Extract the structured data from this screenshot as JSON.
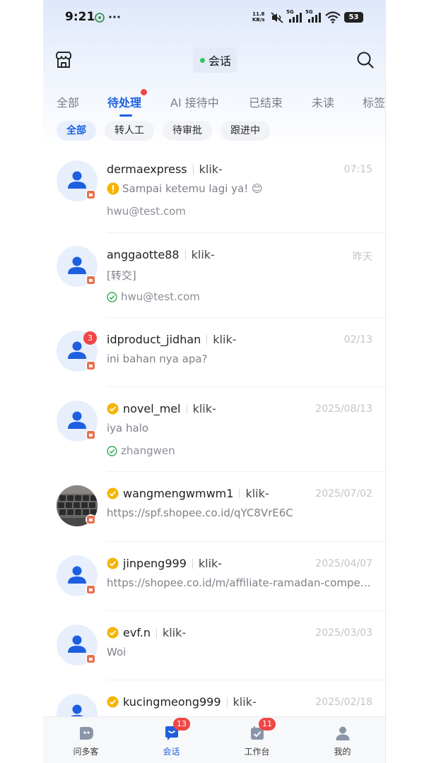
{
  "status_bar": {
    "time": "9:21",
    "net_speed_value": "11.8",
    "net_speed_unit": "KB/s",
    "sig1": "5G",
    "sig2": "5G",
    "battery": "53"
  },
  "header": {
    "title": "会话",
    "store_icon": "store-icon",
    "search_icon": "search-icon"
  },
  "tabs": [
    "全部",
    "待处理",
    "AI 接待中",
    "已结束",
    "未读",
    "标签"
  ],
  "active_tab": "待处理",
  "filters": [
    "全部",
    "转人工",
    "待审批",
    "跟进中"
  ],
  "active_filter": "全部",
  "conversations": [
    {
      "name": "dermaexpress",
      "shop": "klik-",
      "time": "07:15",
      "message": "Sampai ketemu lagi ya! 😊",
      "agent": "hwu@test.com",
      "msg_icon": "warning-icon",
      "verified": false
    },
    {
      "name": "anggaotte88",
      "shop": "klik-",
      "time": "昨天",
      "message": "[转交]",
      "agent": "hwu@test.com",
      "agent_icon": "check-circle-icon",
      "verified": false
    },
    {
      "name": "idproduct_jidhan",
      "shop": "klik-",
      "time": "02/13",
      "message": "ini bahan nya apa?",
      "unread": "3",
      "verified": false
    },
    {
      "name": "novel_mel",
      "shop": "klik-",
      "time": "2025/08/13",
      "message": "iya halo",
      "agent": "zhangwen",
      "agent_icon": "check-circle-icon",
      "verified": true
    },
    {
      "name": "wangmengwmwm1",
      "shop": "klik-",
      "time": "2025/07/02",
      "message": "https://spf.shopee.co.id/qYC8VrE6C",
      "verified": true,
      "photo_avatar": true
    },
    {
      "name": "jinpeng999",
      "shop": "klik-",
      "time": "2025/04/07",
      "message": "https://shopee.co.id/m/affiliate-ramadan-competition",
      "verified": true
    },
    {
      "name": "evf.n",
      "shop": "klik-",
      "time": "2025/03/03",
      "message": "Woi",
      "verified": true
    },
    {
      "name": "kucingmeong999",
      "shop": "klik-",
      "time": "2025/02/18",
      "message": "",
      "verified": true
    }
  ],
  "bottom_nav": [
    {
      "label": "问多客",
      "icon": "chat-bot-icon"
    },
    {
      "label": "会话",
      "icon": "conversation-icon",
      "badge": "13",
      "active": true
    },
    {
      "label": "工作台",
      "icon": "workbench-icon",
      "badge": "11"
    },
    {
      "label": "我的",
      "icon": "profile-icon"
    }
  ],
  "colors": {
    "accent": "#1d5fe0",
    "badge_red": "#f04646",
    "verified_gold": "#f5b400",
    "online_green": "#34c759",
    "store_badge": "#e8714c"
  }
}
